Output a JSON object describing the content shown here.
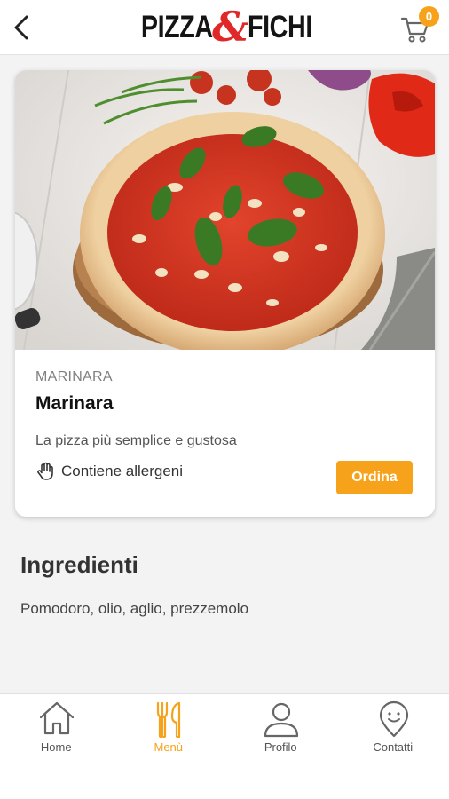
{
  "header": {
    "logo_left": "PIZZA",
    "logo_amp": "&",
    "logo_right": "FICHI",
    "cart_count": "0",
    "back_icon": "chevron-left-icon",
    "cart_icon": "cart-icon"
  },
  "product": {
    "category": "MARINARA",
    "name": "Marinara",
    "description": "La pizza più semplice e gustosa",
    "allergen_icon": "hand-icon",
    "allergen_label": "Contiene allergeni",
    "order_label": "Ordina"
  },
  "ingredients": {
    "title": "Ingredienti",
    "text": "Pomodoro, olio, aglio, prezzemolo"
  },
  "tabs": [
    {
      "label": "Home",
      "icon": "home-icon",
      "active": false
    },
    {
      "label": "Menù",
      "icon": "cutlery-icon",
      "active": true
    },
    {
      "label": "Profilo",
      "icon": "user-icon",
      "active": false
    },
    {
      "label": "Contatti",
      "icon": "location-pin-icon",
      "active": false
    }
  ],
  "colors": {
    "accent": "#f6a21b",
    "logo_amp": "#e12828",
    "background": "#f3f3f3"
  }
}
